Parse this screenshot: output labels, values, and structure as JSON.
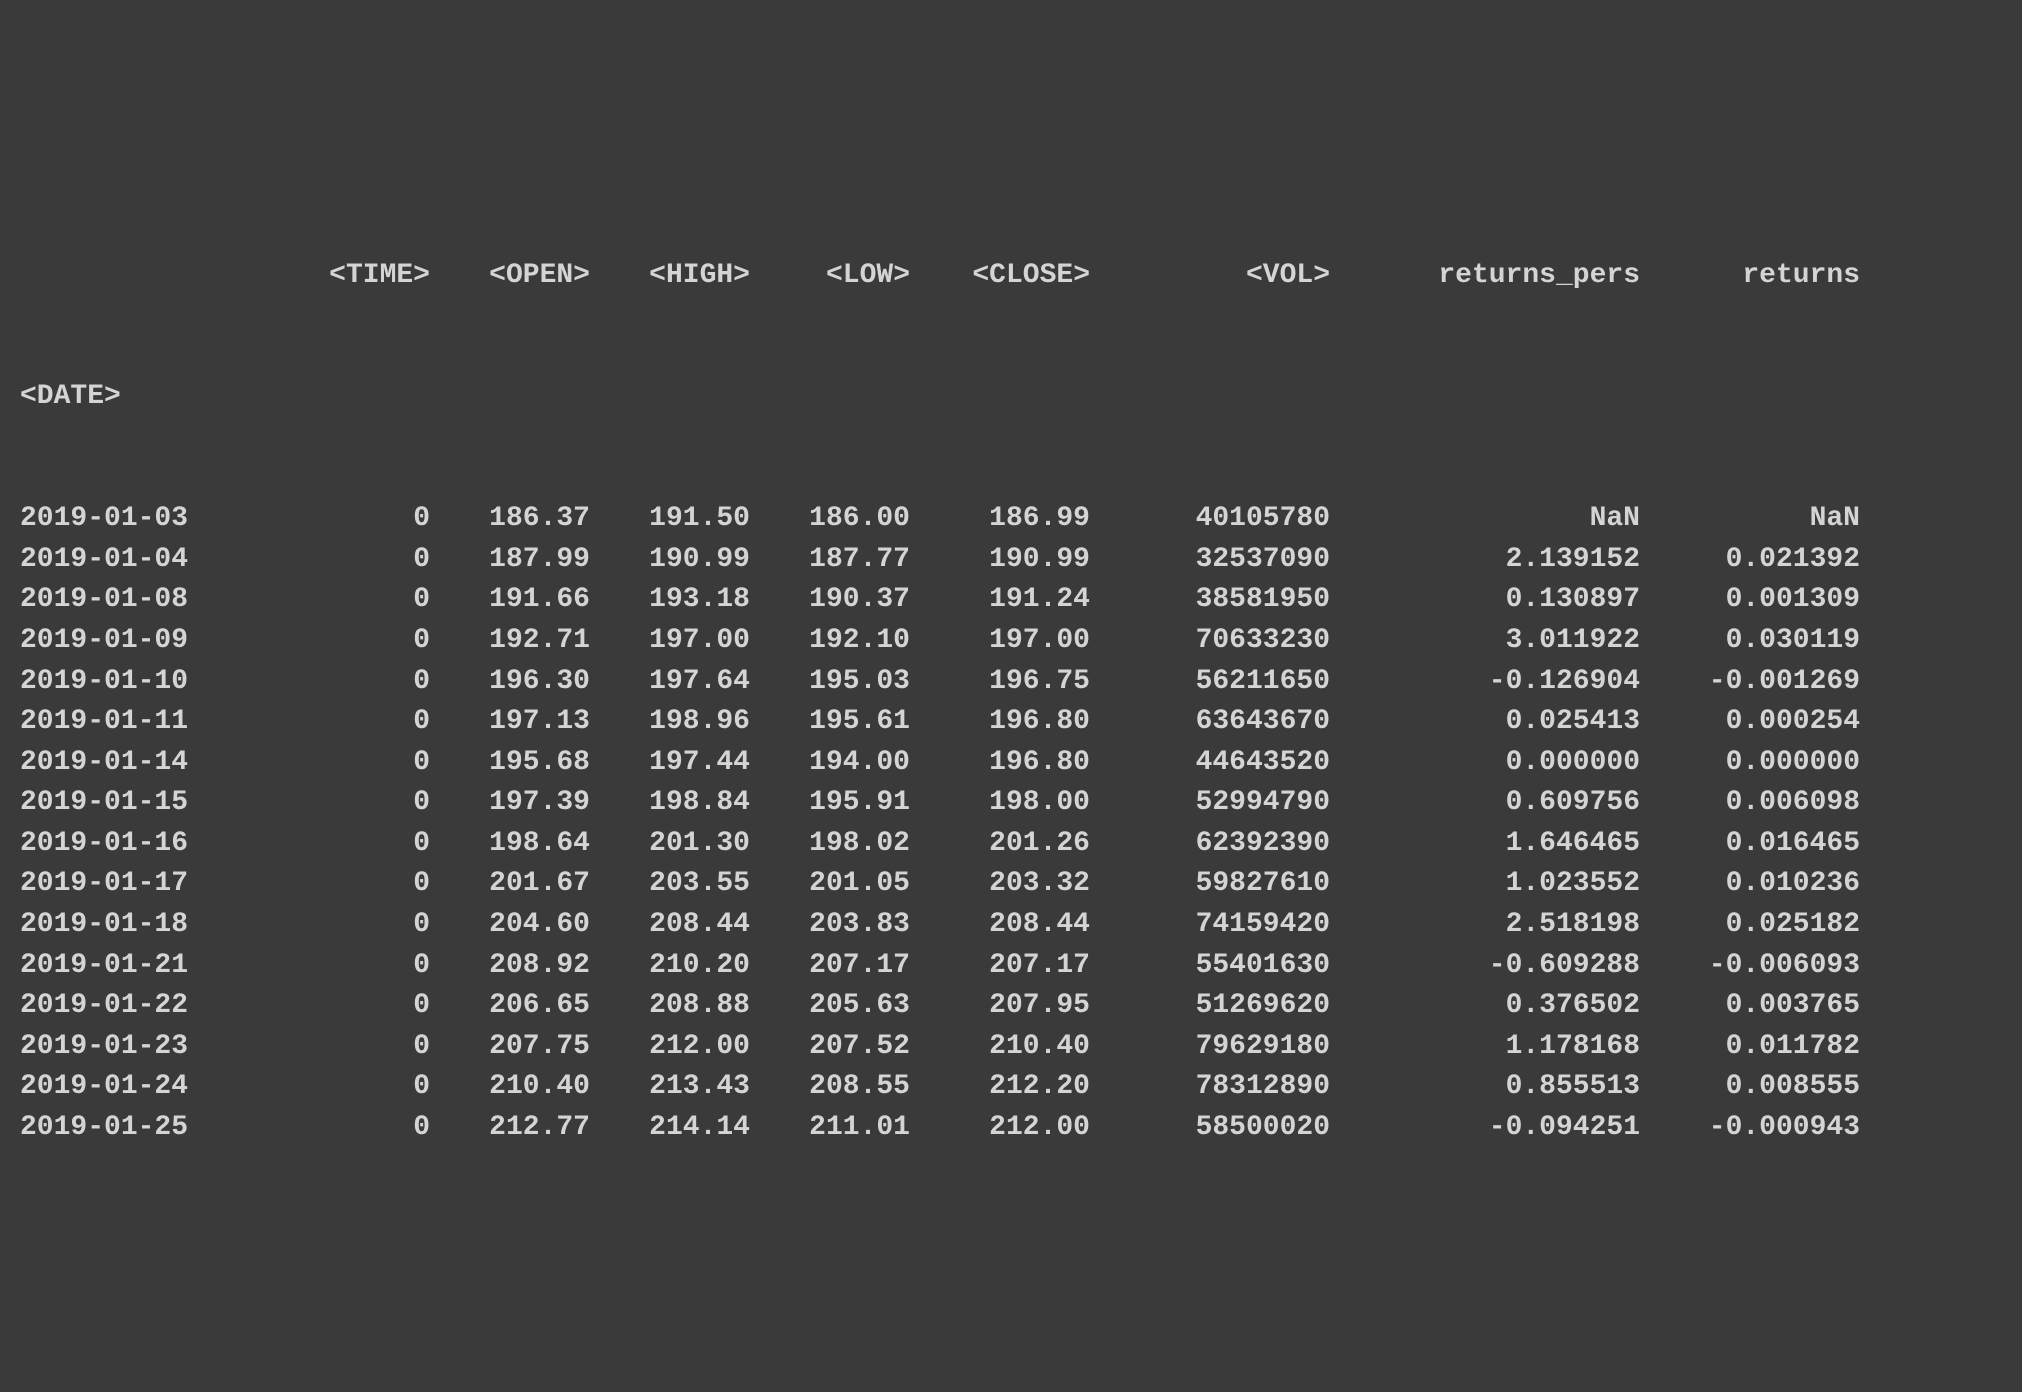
{
  "table": {
    "index_name": "<DATE>",
    "columns": {
      "time": "<TIME>",
      "open": "<OPEN>",
      "high": "<HIGH>",
      "low": "<LOW>",
      "close": "<CLOSE>",
      "vol": "<VOL>",
      "returns_pers": "returns_pers",
      "returns": "returns"
    },
    "rows": [
      {
        "date": "2019-01-03",
        "time": "0",
        "open": "186.37",
        "high": "191.50",
        "low": "186.00",
        "close": "186.99",
        "vol": "40105780",
        "returns_pers": "NaN",
        "returns": "NaN"
      },
      {
        "date": "2019-01-04",
        "time": "0",
        "open": "187.99",
        "high": "190.99",
        "low": "187.77",
        "close": "190.99",
        "vol": "32537090",
        "returns_pers": "2.139152",
        "returns": "0.021392"
      },
      {
        "date": "2019-01-08",
        "time": "0",
        "open": "191.66",
        "high": "193.18",
        "low": "190.37",
        "close": "191.24",
        "vol": "38581950",
        "returns_pers": "0.130897",
        "returns": "0.001309"
      },
      {
        "date": "2019-01-09",
        "time": "0",
        "open": "192.71",
        "high": "197.00",
        "low": "192.10",
        "close": "197.00",
        "vol": "70633230",
        "returns_pers": "3.011922",
        "returns": "0.030119"
      },
      {
        "date": "2019-01-10",
        "time": "0",
        "open": "196.30",
        "high": "197.64",
        "low": "195.03",
        "close": "196.75",
        "vol": "56211650",
        "returns_pers": "-0.126904",
        "returns": "-0.001269"
      },
      {
        "date": "2019-01-11",
        "time": "0",
        "open": "197.13",
        "high": "198.96",
        "low": "195.61",
        "close": "196.80",
        "vol": "63643670",
        "returns_pers": "0.025413",
        "returns": "0.000254"
      },
      {
        "date": "2019-01-14",
        "time": "0",
        "open": "195.68",
        "high": "197.44",
        "low": "194.00",
        "close": "196.80",
        "vol": "44643520",
        "returns_pers": "0.000000",
        "returns": "0.000000"
      },
      {
        "date": "2019-01-15",
        "time": "0",
        "open": "197.39",
        "high": "198.84",
        "low": "195.91",
        "close": "198.00",
        "vol": "52994790",
        "returns_pers": "0.609756",
        "returns": "0.006098"
      },
      {
        "date": "2019-01-16",
        "time": "0",
        "open": "198.64",
        "high": "201.30",
        "low": "198.02",
        "close": "201.26",
        "vol": "62392390",
        "returns_pers": "1.646465",
        "returns": "0.016465"
      },
      {
        "date": "2019-01-17",
        "time": "0",
        "open": "201.67",
        "high": "203.55",
        "low": "201.05",
        "close": "203.32",
        "vol": "59827610",
        "returns_pers": "1.023552",
        "returns": "0.010236"
      },
      {
        "date": "2019-01-18",
        "time": "0",
        "open": "204.60",
        "high": "208.44",
        "low": "203.83",
        "close": "208.44",
        "vol": "74159420",
        "returns_pers": "2.518198",
        "returns": "0.025182"
      },
      {
        "date": "2019-01-21",
        "time": "0",
        "open": "208.92",
        "high": "210.20",
        "low": "207.17",
        "close": "207.17",
        "vol": "55401630",
        "returns_pers": "-0.609288",
        "returns": "-0.006093"
      },
      {
        "date": "2019-01-22",
        "time": "0",
        "open": "206.65",
        "high": "208.88",
        "low": "205.63",
        "close": "207.95",
        "vol": "51269620",
        "returns_pers": "0.376502",
        "returns": "0.003765"
      },
      {
        "date": "2019-01-23",
        "time": "0",
        "open": "207.75",
        "high": "212.00",
        "low": "207.52",
        "close": "210.40",
        "vol": "79629180",
        "returns_pers": "1.178168",
        "returns": "0.011782"
      },
      {
        "date": "2019-01-24",
        "time": "0",
        "open": "210.40",
        "high": "213.43",
        "low": "208.55",
        "close": "212.20",
        "vol": "78312890",
        "returns_pers": "0.855513",
        "returns": "0.008555"
      },
      {
        "date": "2019-01-25",
        "time": "0",
        "open": "212.77",
        "high": "214.14",
        "low": "211.01",
        "close": "212.00",
        "vol": "58500020",
        "returns_pers": "-0.094251",
        "returns": "-0.000943"
      }
    ]
  }
}
